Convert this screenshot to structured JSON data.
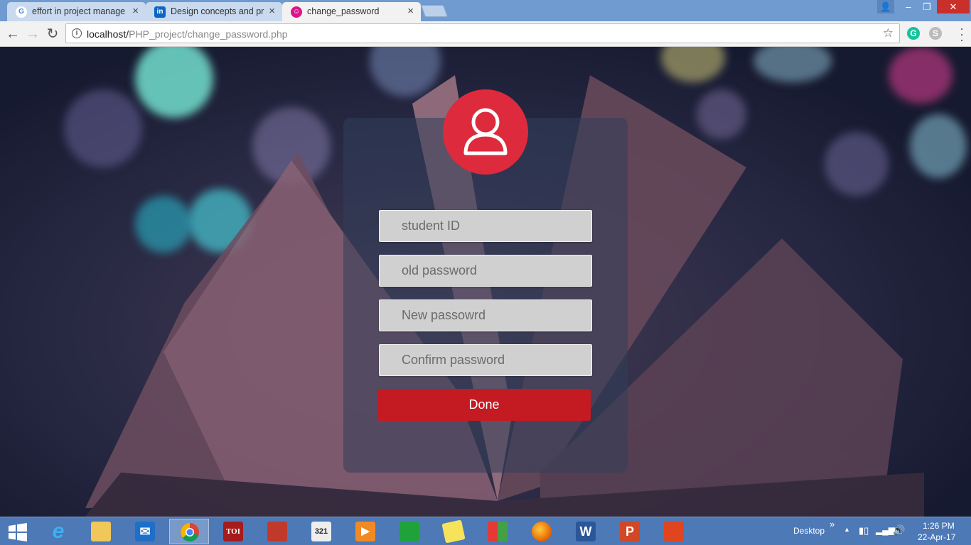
{
  "browser": {
    "tabs": [
      {
        "title": "effort in project manage",
        "favicon": "google-icon",
        "active": false
      },
      {
        "title": "Design concepts and prin",
        "favicon": "linkedin-icon",
        "active": false
      },
      {
        "title": "change_password",
        "favicon": "php-app-icon",
        "active": true
      }
    ],
    "tab_close_glyph": "×",
    "address_bar": {
      "host": "localhost/",
      "path": "PHP_project/change_password.php"
    },
    "window_controls": {
      "minimize": "‒",
      "restore": "❐",
      "close": "✕"
    }
  },
  "form": {
    "avatar_icon": "user-icon",
    "fields": [
      {
        "name": "student-id",
        "placeholder": "student ID",
        "value": ""
      },
      {
        "name": "old-password",
        "placeholder": "old password",
        "value": ""
      },
      {
        "name": "new-password",
        "placeholder": "New passowrd",
        "value": ""
      },
      {
        "name": "confirm-password",
        "placeholder": "Confirm password",
        "value": ""
      }
    ],
    "submit_label": "Done",
    "colors": {
      "accent": "#dd2a3c",
      "button": "#c41a22",
      "field_bg": "#d0d0d0"
    }
  },
  "taskbar": {
    "apps": [
      {
        "icon": "internet-explorer-icon",
        "label": "e"
      },
      {
        "icon": "file-explorer-icon",
        "label": ""
      },
      {
        "icon": "outlook-icon",
        "label": "✉"
      },
      {
        "icon": "chrome-icon",
        "label": "",
        "active": true
      },
      {
        "icon": "times-of-india-icon",
        "label": "TOI"
      },
      {
        "icon": "app-icon",
        "label": ""
      },
      {
        "icon": "calendar-app-icon",
        "label": "321"
      },
      {
        "icon": "media-player-icon",
        "label": "▶"
      },
      {
        "icon": "store-icon",
        "label": ""
      },
      {
        "icon": "sticky-notes-icon",
        "label": ""
      },
      {
        "icon": "tiles-app-icon",
        "label": ""
      },
      {
        "icon": "firefox-icon",
        "label": ""
      },
      {
        "icon": "word-icon",
        "label": "W"
      },
      {
        "icon": "powerpoint-icon",
        "label": "P"
      },
      {
        "icon": "acrobat-icon",
        "label": ""
      }
    ],
    "desktop_label": "Desktop",
    "chevron": "»",
    "time": "1:26 PM",
    "date": "22-Apr-17"
  }
}
